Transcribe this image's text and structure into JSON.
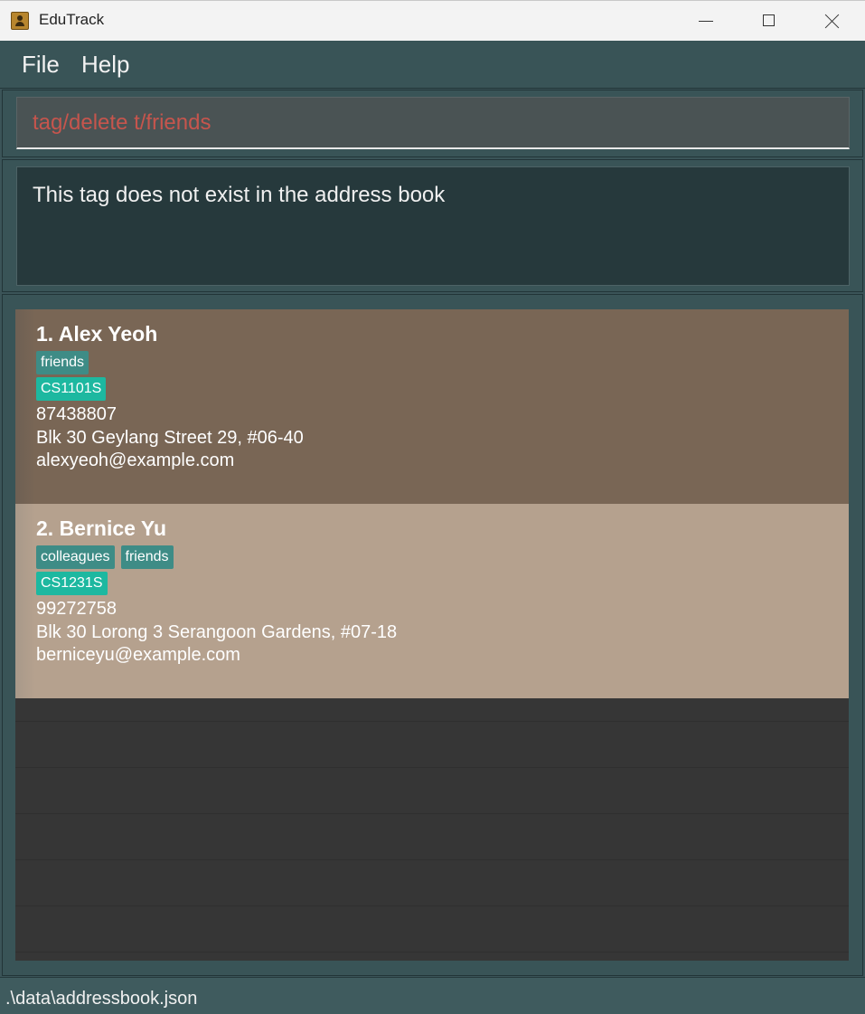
{
  "window": {
    "title": "EduTrack"
  },
  "menu": {
    "items": [
      "File",
      "Help"
    ]
  },
  "command_box": {
    "value": "tag/delete t/friends"
  },
  "result_display": {
    "text": "This tag does not exist in the address book"
  },
  "persons": [
    {
      "index_name": "1.  Alex Yeoh",
      "tags": [
        "friends"
      ],
      "courses": [
        "CS1101S"
      ],
      "phone": "87438807",
      "address": "Blk 30 Geylang Street 29, #06-40",
      "email": "alexyeoh@example.com"
    },
    {
      "index_name": "2.  Bernice Yu",
      "tags": [
        "colleagues",
        "friends"
      ],
      "courses": [
        "CS1231S"
      ],
      "phone": "99272758",
      "address": "Blk 30 Lorong 3 Serangoon Gardens, #07-18",
      "email": "berniceyu@example.com"
    }
  ],
  "status_bar": {
    "path": ".\\data\\addressbook.json"
  },
  "colors": {
    "card_selected": "#796655",
    "card_normal": "#b5a18e",
    "tag": "#3e8c86",
    "course_tag": "#1db8a0",
    "command_text": "#c6554d"
  }
}
